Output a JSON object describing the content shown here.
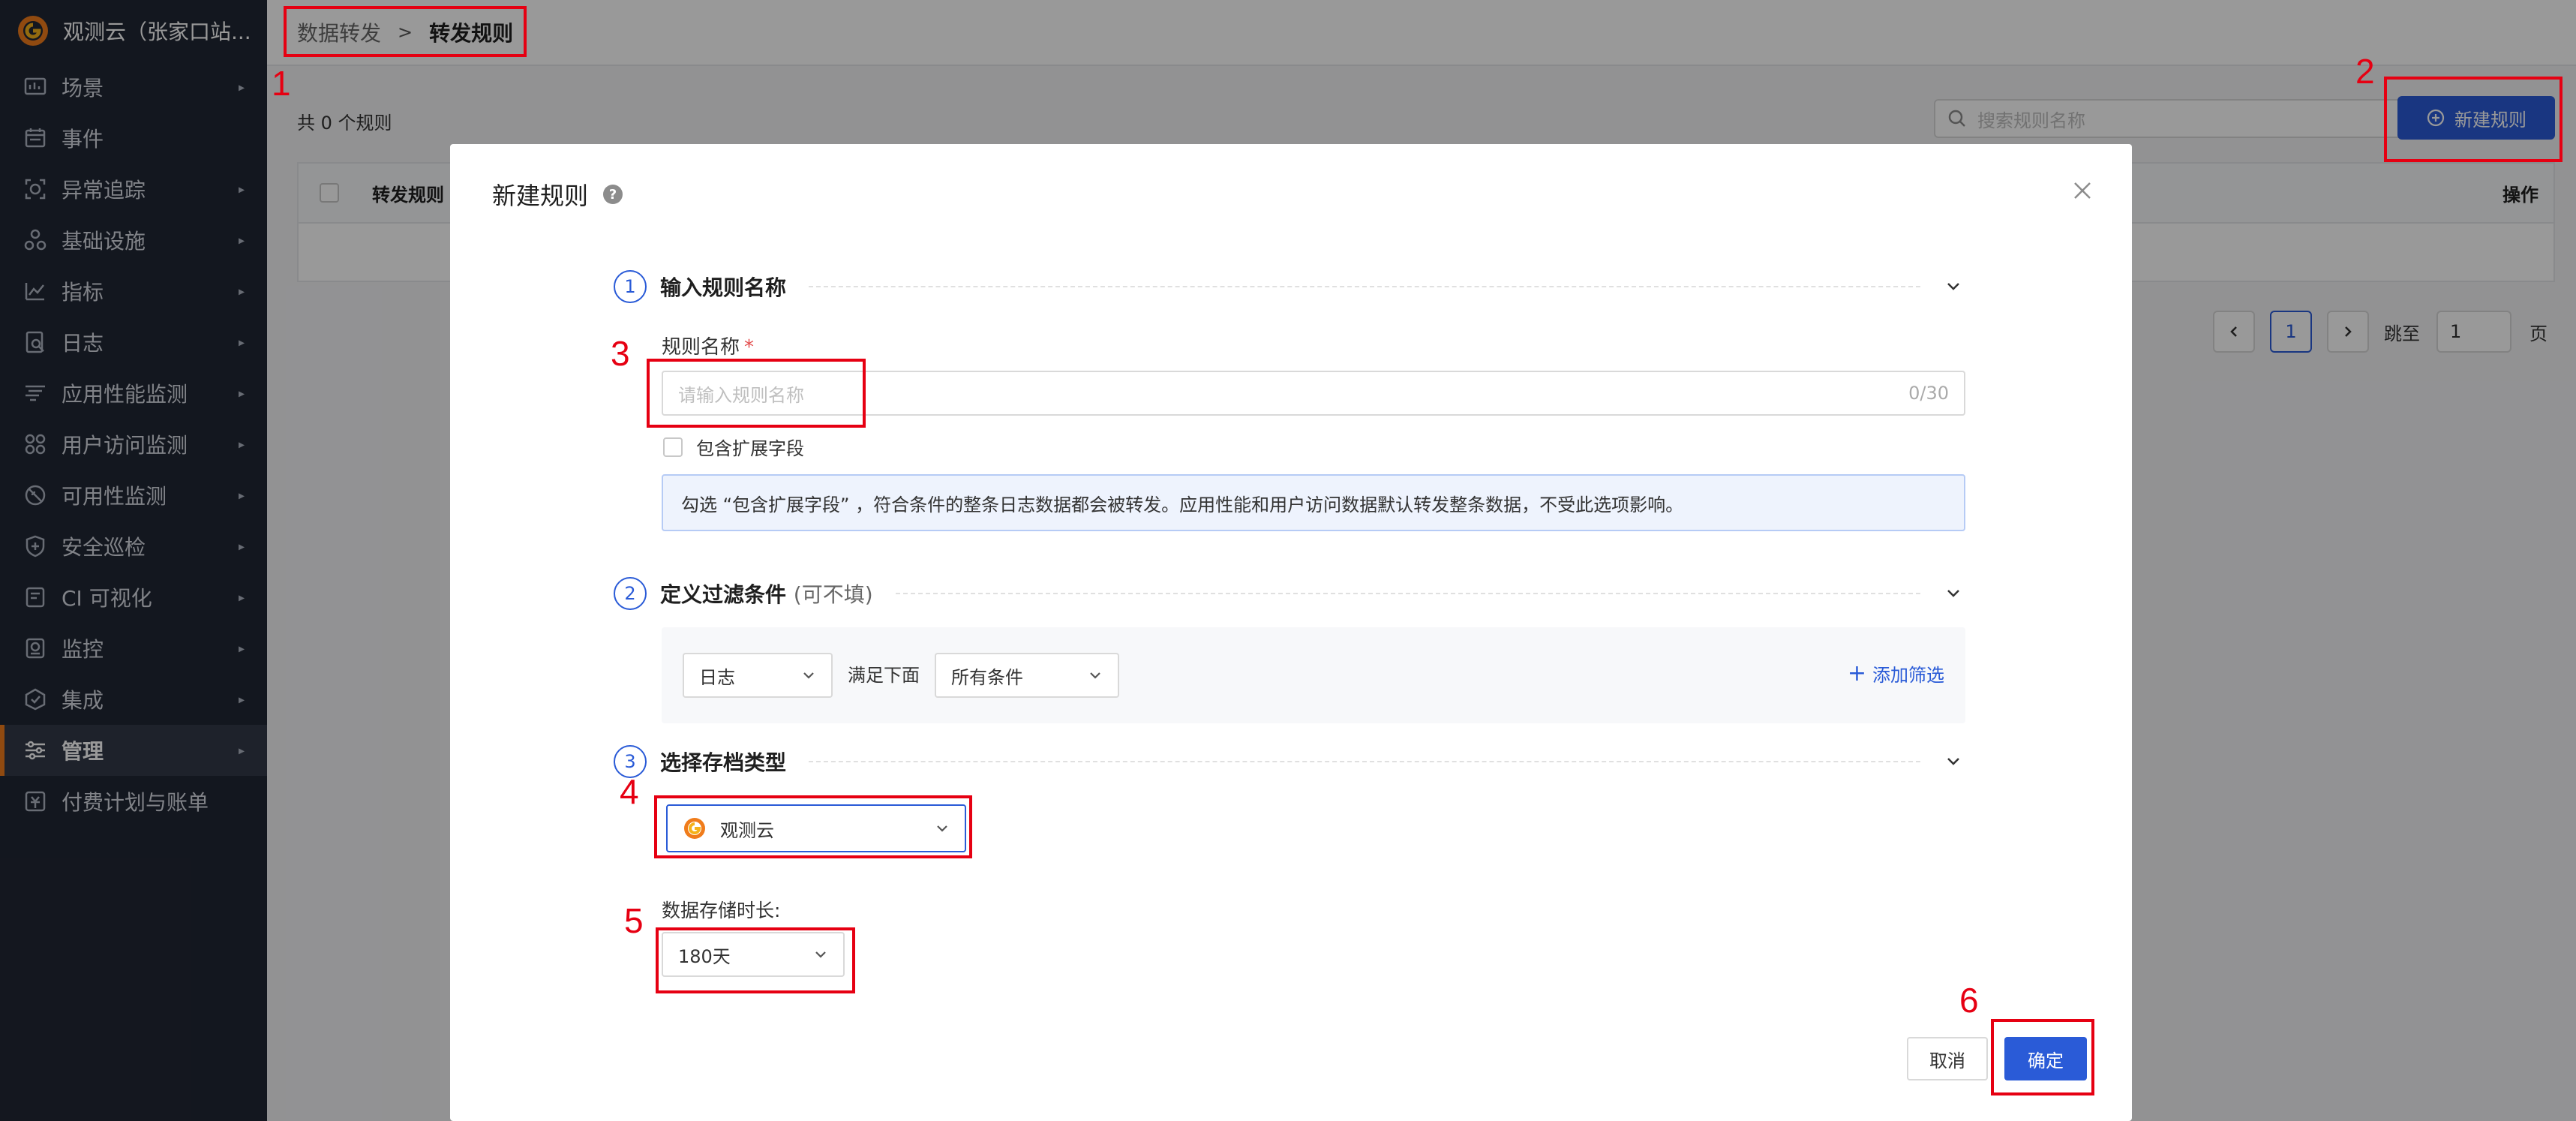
{
  "app": {
    "name": "观测云（张家口站..."
  },
  "sidebar": {
    "items": [
      {
        "label": "场景",
        "icon": "dashboard-icon",
        "has_arrow": true
      },
      {
        "label": "事件",
        "icon": "calendar-icon",
        "has_arrow": false
      },
      {
        "label": "异常追踪",
        "icon": "bug-icon",
        "has_arrow": true
      },
      {
        "label": "基础设施",
        "icon": "infrastructure-icon",
        "has_arrow": true
      },
      {
        "label": "指标",
        "icon": "metrics-icon",
        "has_arrow": true
      },
      {
        "label": "日志",
        "icon": "log-icon",
        "has_arrow": true
      },
      {
        "label": "应用性能监测",
        "icon": "apm-icon",
        "has_arrow": true
      },
      {
        "label": "用户访问监测",
        "icon": "rum-icon",
        "has_arrow": true
      },
      {
        "label": "可用性监测",
        "icon": "availability-icon",
        "has_arrow": true
      },
      {
        "label": "安全巡检",
        "icon": "shield-icon",
        "has_arrow": true
      },
      {
        "label": "CI 可视化",
        "icon": "ci-icon",
        "has_arrow": true
      },
      {
        "label": "监控",
        "icon": "monitor-icon",
        "has_arrow": true
      },
      {
        "label": "集成",
        "icon": "integration-icon",
        "has_arrow": true
      },
      {
        "label": "管理",
        "icon": "settings-sliders-icon",
        "has_arrow": true,
        "active": true
      },
      {
        "label": "付费计划与账单",
        "icon": "billing-icon",
        "has_arrow": false
      }
    ]
  },
  "breadcrumb": {
    "parent": "数据转发",
    "separator": ">",
    "current": "转发规则"
  },
  "list": {
    "count_text": "共 0 个规则",
    "search_placeholder": "搜索规则名称",
    "new_button": "新建规则",
    "columns": {
      "rule": "转发规则",
      "action": "操作"
    }
  },
  "pagination": {
    "current_page": "1",
    "jump_label": "跳至",
    "jump_value": "1",
    "page_unit": "页"
  },
  "modal": {
    "title": "新建规则",
    "step1": {
      "num": "1",
      "title": "输入规则名称",
      "field_label": "规则名称",
      "required_mark": "*",
      "placeholder": "请输入规则名称",
      "counter": "0/30",
      "checkbox_label": "包含扩展字段",
      "info": "勾选 “包含扩展字段” ，符合条件的整条日志数据都会被转发。应用性能和用户访问数据默认转发整条数据，不受此选项影响。"
    },
    "step2": {
      "num": "2",
      "title": "定义过滤条件",
      "hint": "(可不填)",
      "source_value": "日志",
      "condition_text": "满足下面",
      "condition_value": "所有条件",
      "add_filter": "添加筛选"
    },
    "step3": {
      "num": "3",
      "title": "选择存档类型",
      "archive_value": "观测云",
      "retention_label": "数据存储时长:",
      "retention_value": "180天"
    },
    "cancel": "取消",
    "confirm": "确定"
  },
  "annotations": [
    "1",
    "2",
    "3",
    "4",
    "5",
    "6"
  ],
  "colors": {
    "accent": "#2a5bd7",
    "sidebar_bg": "#212734",
    "annotation": "#e60012",
    "brand_orange": "#f07c1b"
  }
}
